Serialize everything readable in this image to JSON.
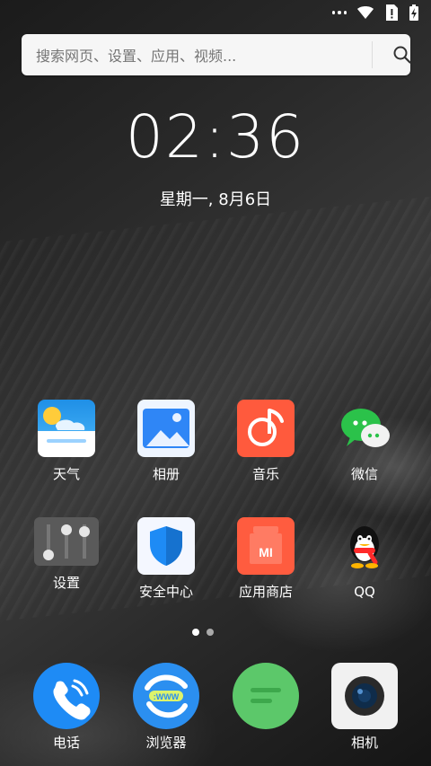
{
  "search": {
    "placeholder": "搜索网页、设置、应用、视频..."
  },
  "clock": {
    "time": "02:36",
    "date": "星期一, 8月6日"
  },
  "apps_row1": [
    {
      "label": "天气",
      "icon": "weather-icon"
    },
    {
      "label": "相册",
      "icon": "gallery-icon"
    },
    {
      "label": "音乐",
      "icon": "music-icon"
    },
    {
      "label": "微信",
      "icon": "wechat-icon"
    }
  ],
  "apps_row2": [
    {
      "label": "设置",
      "icon": "settings-icon"
    },
    {
      "label": "安全中心",
      "icon": "security-center-icon"
    },
    {
      "label": "应用商店",
      "icon": "app-store-icon"
    },
    {
      "label": "QQ",
      "icon": "qq-icon"
    }
  ],
  "dock": [
    {
      "label": "电话",
      "icon": "phone-icon"
    },
    {
      "label": "浏览器",
      "icon": "browser-icon"
    },
    {
      "label": "",
      "icon": "messages-icon"
    },
    {
      "label": "相机",
      "icon": "camera-icon"
    }
  ],
  "pager": {
    "pages": 2,
    "current": 1
  }
}
